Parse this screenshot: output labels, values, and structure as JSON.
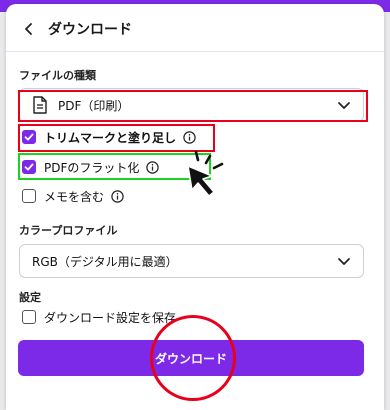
{
  "header": {
    "title": "ダウンロード"
  },
  "file_type": {
    "label": "ファイルの種類",
    "selected": "PDF（印刷）"
  },
  "options": [
    {
      "label": "トリムマークと塗り足し",
      "checked": true,
      "info": true
    },
    {
      "label": "PDFのフラット化",
      "checked": true,
      "info": true
    },
    {
      "label": "メモを含む",
      "checked": false,
      "info": true
    }
  ],
  "color_profile": {
    "label": "カラープロファイル",
    "selected": "RGB（デジタル用に最適）"
  },
  "settings": {
    "label": "設定",
    "save_label": "ダウンロード設定を保存",
    "save_checked": false
  },
  "download_button": "ダウンロード",
  "colors": {
    "accent": "#7d2ae8",
    "annotation_red": "#e8001c",
    "annotation_green": "#1ed31e"
  }
}
